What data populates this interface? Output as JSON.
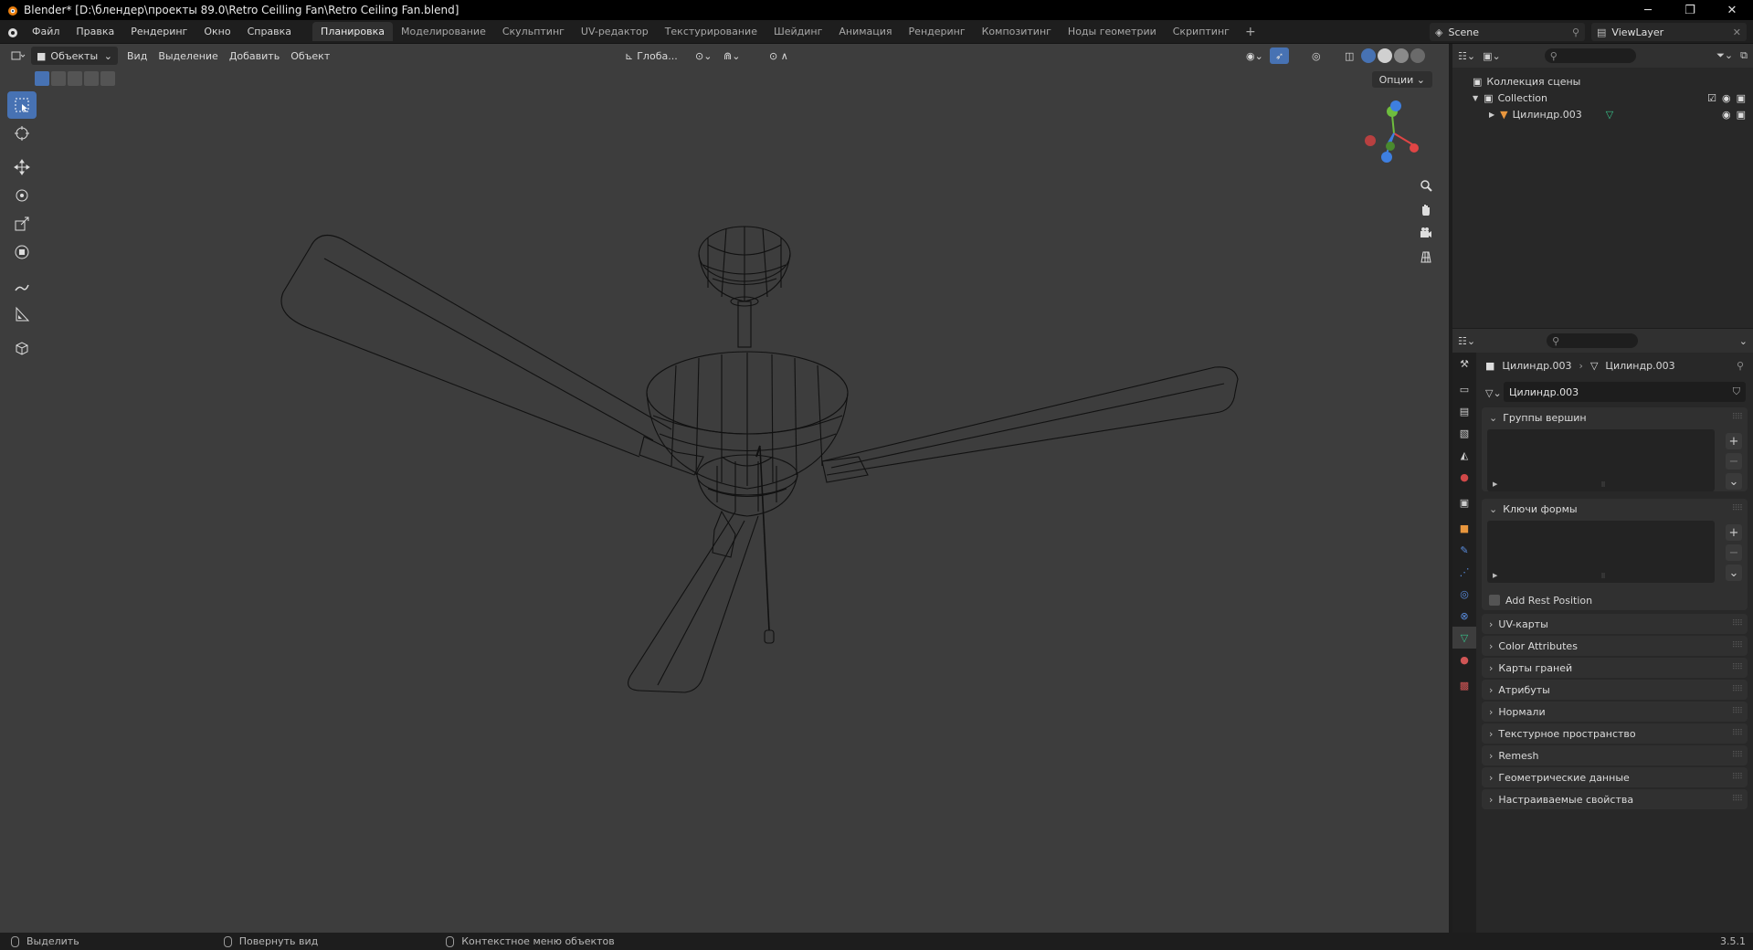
{
  "window": {
    "title": "Blender* [D:\\блендер\\проекты 89.0\\Retro Ceilling Fan\\Retro Ceiling Fan.blend]",
    "minimize": "─",
    "maximize": "❐",
    "close": "✕"
  },
  "menu": [
    "Файл",
    "Правка",
    "Рендеринг",
    "Окно",
    "Справка"
  ],
  "workspaces": [
    {
      "label": "Планировка",
      "active": true
    },
    {
      "label": "Моделирование"
    },
    {
      "label": "Скульптинг"
    },
    {
      "label": "UV-редактор"
    },
    {
      "label": "Текстурирование"
    },
    {
      "label": "Шейдинг"
    },
    {
      "label": "Анимация"
    },
    {
      "label": "Рендеринг"
    },
    {
      "label": "Композитинг"
    },
    {
      "label": "Ноды геометрии"
    },
    {
      "label": "Скриптинг"
    }
  ],
  "workspace_add": "+",
  "scene": "Scene",
  "view_layer": "ViewLayer",
  "viewport": {
    "mode": "Объекты",
    "menus": [
      "Вид",
      "Выделение",
      "Добавить",
      "Объект"
    ],
    "orientation": "Глоба...",
    "options": "Опции"
  },
  "outliner": {
    "scene_collection": "Коллекция сцены",
    "collection": "Collection",
    "object": "Цилиндр.003"
  },
  "properties": {
    "object_name": "Цилиндр.003",
    "mesh_name": "Цилиндр.003",
    "datablock": "Цилиндр.003",
    "panels": {
      "vertex_groups": "Группы вершин",
      "shape_keys": "Ключи формы",
      "add_rest_position": "Add Rest Position"
    },
    "collapsed_panels": [
      "UV-карты",
      "Color Attributes",
      "Карты граней",
      "Атрибуты",
      "Нормали",
      "Текстурное пространство",
      "Remesh",
      "Геометрические данные",
      "Настраиваемые свойства"
    ]
  },
  "statusbar": {
    "select": "Выделить",
    "rotate": "Повернуть вид",
    "context": "Контекстное меню объектов",
    "version": "3.5.1"
  },
  "colors": {
    "accent": "#4772b3",
    "viewport_bg": "#3d3d3d",
    "wire": "#111111",
    "axis_x": "#e04545",
    "axis_y": "#6ebd3e",
    "axis_z": "#3e7fe0"
  }
}
